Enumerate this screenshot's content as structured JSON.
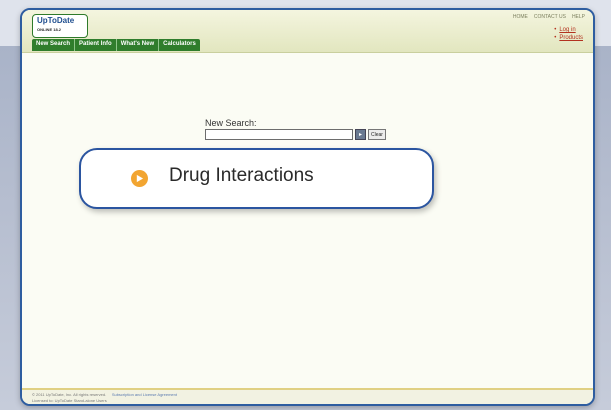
{
  "app": {
    "logo_name": "UpToDate",
    "logo_sub": "ONLINE 18.2"
  },
  "top_links": [
    "HOME",
    "CONTACT US",
    "HELP"
  ],
  "right_links": [
    "Log in",
    "Products"
  ],
  "nav": [
    "New Search",
    "Patient Info",
    "What's New",
    "Calculators"
  ],
  "search": {
    "label": "New Search:",
    "value": "",
    "clear_label": "Clear"
  },
  "callout": {
    "text": "Drug Interactions",
    "icon": "play-arrow-icon",
    "accent": "#f2a531",
    "border": "#2b55a0"
  },
  "footer": {
    "copyright": "© 2011 UpToDate, Inc. All rights reserved.",
    "license_link": "Subscription and License Agreement",
    "powered_by": "Licensed to: UpToDate Stand-alone Users"
  },
  "colors": {
    "nav_bg": "#2f7d2c",
    "link_red": "#b3321f",
    "frame_blue": "#2e5da0"
  }
}
